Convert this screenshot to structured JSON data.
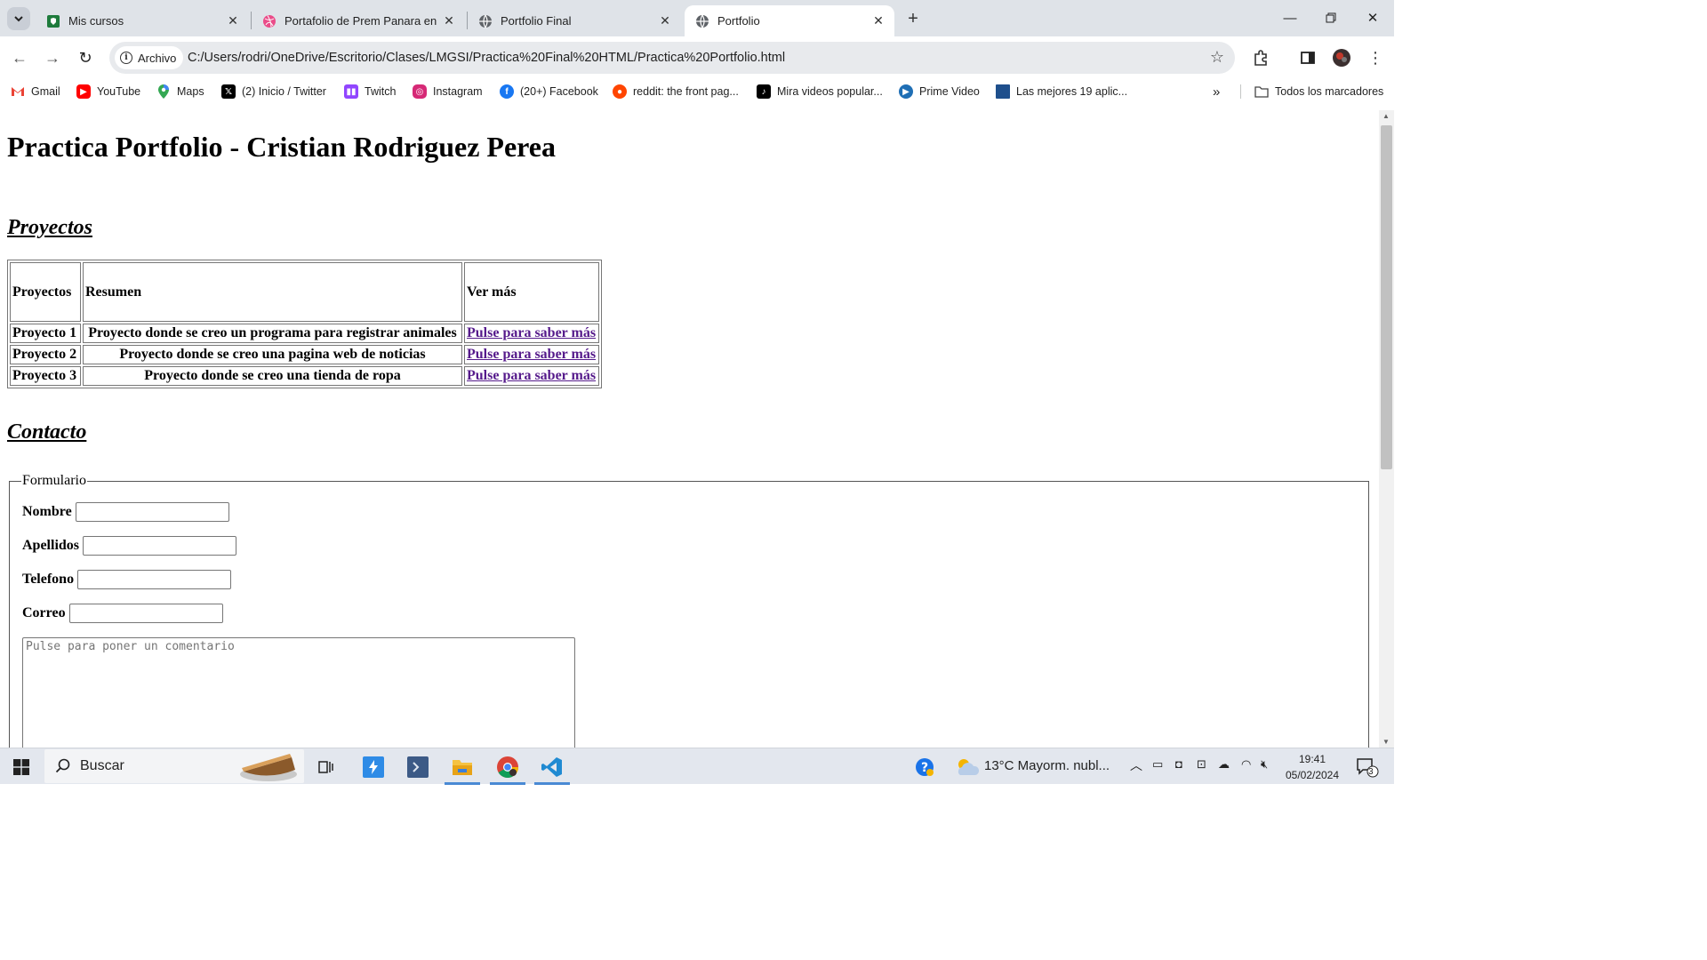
{
  "browser": {
    "tabs": [
      {
        "title": "Mis cursos",
        "active": false
      },
      {
        "title": "Portafolio de Prem Panara en D",
        "active": false
      },
      {
        "title": "Portfolio Final",
        "active": false
      },
      {
        "title": "Portfolio",
        "active": true
      }
    ],
    "address": {
      "chip_label": "Archivo",
      "url": "C:/Users/rodri/OneDrive/Escritorio/Clases/LMGSI/Practica%20Final%20HTML/Practica%20Portfolio.html"
    },
    "bookmarks": [
      {
        "label": "Gmail",
        "icon": "gmail-icon"
      },
      {
        "label": "YouTube",
        "icon": "youtube-icon"
      },
      {
        "label": "Maps",
        "icon": "maps-icon"
      },
      {
        "label": "(2) Inicio / Twitter",
        "icon": "x-twitter-icon"
      },
      {
        "label": "Twitch",
        "icon": "twitch-icon"
      },
      {
        "label": "Instagram",
        "icon": "instagram-icon"
      },
      {
        "label": "(20+) Facebook",
        "icon": "facebook-icon"
      },
      {
        "label": "reddit: the front pag...",
        "icon": "reddit-icon"
      },
      {
        "label": "Mira videos popular...",
        "icon": "tiktok-icon"
      },
      {
        "label": "Prime Video",
        "icon": "prime-video-icon"
      },
      {
        "label": "Las mejores 19 aplic...",
        "icon": "site-icon"
      }
    ],
    "all_bookmarks_label": "Todos los marcadores"
  },
  "page": {
    "title": "Practica Portfolio - Cristian Rodriguez Perea",
    "projects_heading": "Proyectos",
    "table": {
      "headers": [
        "Proyectos",
        "Resumen",
        "Ver más"
      ],
      "rows": [
        {
          "name": "Proyecto 1",
          "summary": "Proyecto donde se creo un programa para registrar animales",
          "link": "Pulse para saber más"
        },
        {
          "name": "Proyecto 2",
          "summary": "Proyecto donde se creo una pagina web de noticias",
          "link": "Pulse para saber más"
        },
        {
          "name": "Proyecto 3",
          "summary": "Proyecto donde se creo una tienda de ropa",
          "link": "Pulse para saber más"
        }
      ]
    },
    "contact_heading": "Contacto",
    "form": {
      "legend": "Formulario",
      "fields": [
        {
          "label": "Nombre",
          "value": ""
        },
        {
          "label": "Apellidos",
          "value": ""
        },
        {
          "label": "Telefono",
          "value": ""
        },
        {
          "label": "Correo",
          "value": ""
        }
      ],
      "comment_placeholder": "Pulse para poner un comentario"
    }
  },
  "taskbar": {
    "search_label": "Buscar",
    "weather": "13°C  Mayorm. nubl...",
    "time": "19:41",
    "date": "05/02/2024",
    "notification_count": "3"
  }
}
